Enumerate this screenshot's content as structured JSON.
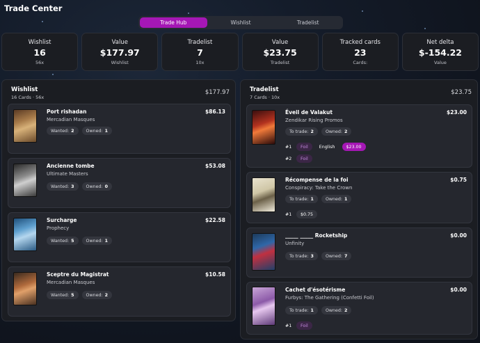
{
  "app": {
    "title": "Trade Center"
  },
  "tabs": [
    {
      "label": "Trade Hub",
      "active": true
    },
    {
      "label": "Wishlist",
      "active": false
    },
    {
      "label": "Tradelist",
      "active": false
    }
  ],
  "stats": [
    {
      "label": "Wishlist",
      "value": "16",
      "sub": "56x"
    },
    {
      "label": "Value",
      "value": "$177.97",
      "sub": "Wishlist"
    },
    {
      "label": "Tradelist",
      "value": "7",
      "sub": "10x"
    },
    {
      "label": "Value",
      "value": "$23.75",
      "sub": "Tradelist"
    },
    {
      "label": "Tracked cards",
      "value": "23",
      "sub": "Cards:"
    },
    {
      "label": "Net delta",
      "value": "$-154.22",
      "sub": "Value"
    }
  ],
  "wishlist": {
    "title": "Wishlist",
    "subtitle": "16 Cards · 56x",
    "total": "$177.97",
    "cards": [
      {
        "name": "Port rishadan",
        "set": "Mercadian Masques",
        "price": "$86.13",
        "wanted_label": "Wanted:",
        "wanted": "2",
        "owned_label": "Owned:",
        "owned": "1"
      },
      {
        "name": "Ancienne tombe",
        "set": "Ultimate Masters",
        "price": "$53.08",
        "wanted_label": "Wanted:",
        "wanted": "3",
        "owned_label": "Owned:",
        "owned": "0"
      },
      {
        "name": "Surcharge",
        "set": "Prophecy",
        "price": "$22.58",
        "wanted_label": "Wanted:",
        "wanted": "5",
        "owned_label": "Owned:",
        "owned": "1"
      },
      {
        "name": "Sceptre du Magistrat",
        "set": "Mercadian Masques",
        "price": "$10.58",
        "wanted_label": "Wanted:",
        "wanted": "5",
        "owned_label": "Owned:",
        "owned": "2"
      }
    ]
  },
  "tradelist": {
    "title": "Tradelist",
    "subtitle": "7 Cards · 10x",
    "total": "$23.75",
    "cards": [
      {
        "name": "Éveil de Valakut",
        "set": "Zendikar Rising Promos",
        "price": "$23.00",
        "trade_label": "To trade:",
        "trade": "2",
        "owned_label": "Owned:",
        "owned": "2",
        "rows": [
          {
            "num": "#1",
            "foil": "Foil",
            "lang": "English",
            "price": "$23.00"
          },
          {
            "num": "#2",
            "foil": "Foil"
          }
        ]
      },
      {
        "name": "Récompense de la foi",
        "set": "Conspiracy: Take the Crown",
        "price": "$0.75",
        "trade_label": "To trade:",
        "trade": "1",
        "owned_label": "Owned:",
        "owned": "1",
        "rows": [
          {
            "num": "#1",
            "price": "$0.75"
          }
        ]
      },
      {
        "name": "_____ _____ Rocketship",
        "set": "Unfinity",
        "price": "$0.00",
        "trade_label": "To trade:",
        "trade": "3",
        "owned_label": "Owned:",
        "owned": "7"
      },
      {
        "name": "Cachet d'ésotérisme",
        "set": "Furbys: The Gathering (Confetti Foil)",
        "price": "$0.00",
        "trade_label": "To trade:",
        "trade": "1",
        "owned_label": "Owned:",
        "owned": "2",
        "rows": [
          {
            "num": "#1",
            "foil": "Foil"
          }
        ]
      }
    ]
  },
  "colors": {
    "accent": "#a517b5",
    "panel": "#1b1d22",
    "card": "#25272e",
    "foil_text": "#c58ae0"
  }
}
